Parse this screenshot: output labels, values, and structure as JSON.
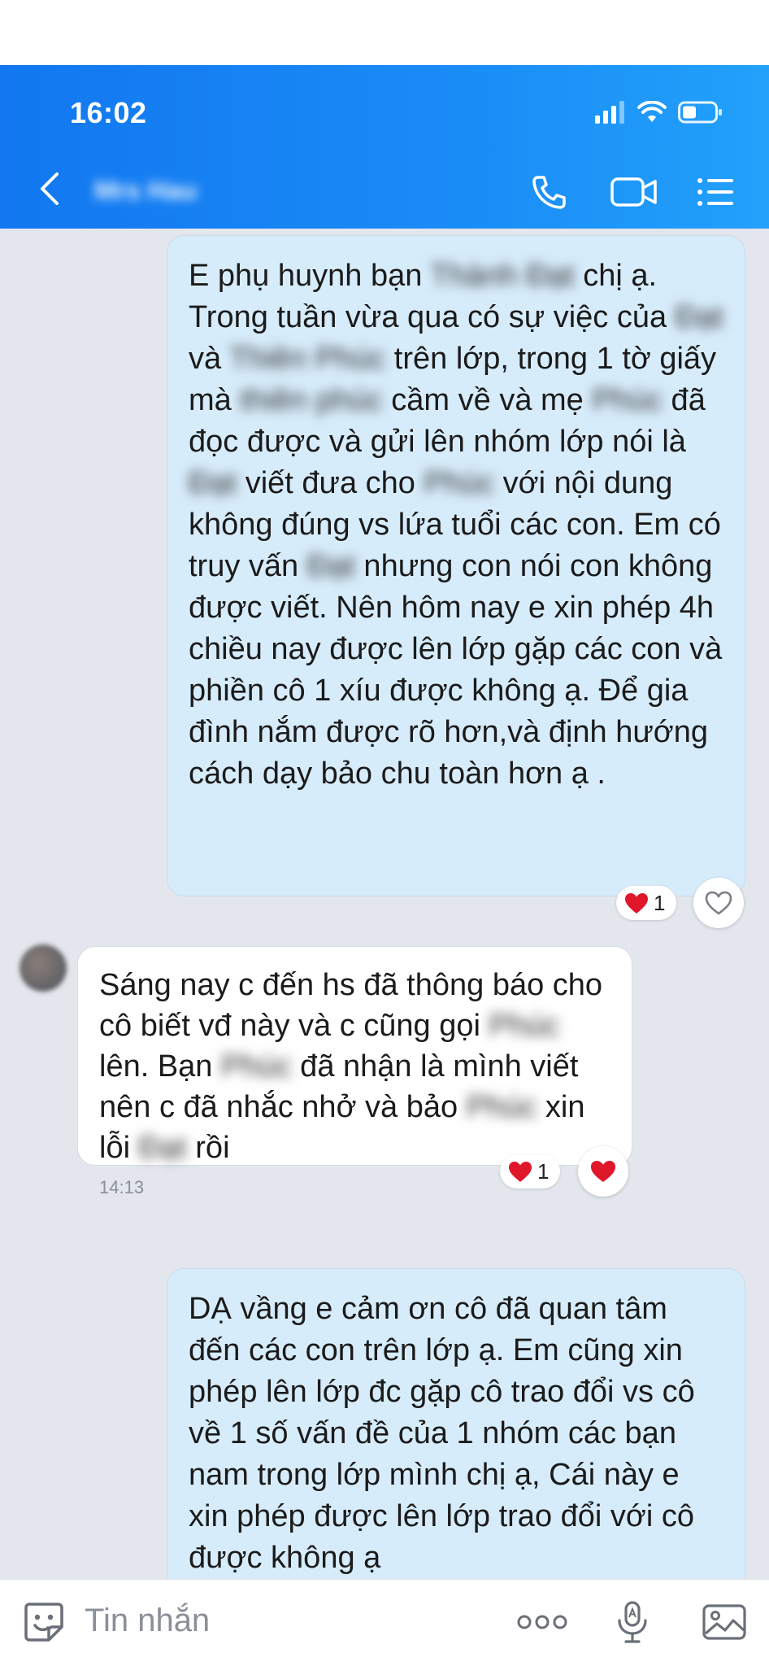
{
  "status_bar": {
    "time": "16:02"
  },
  "header": {
    "contact_name": "Mrs Hau"
  },
  "messages": [
    {
      "segments": [
        "E phụ huynh bạn ",
        "Thành Đạt",
        " chị ạ. Trong tuần vừa qua có sự việc của ",
        "Đạt",
        " và ",
        "Thiên Phúc",
        " trên lớp, trong 1 tờ giấy mà ",
        "thiên phúc",
        " cầm về và mẹ ",
        "Phúc",
        " đã đọc được và gửi lên nhóm lớp nói là ",
        "Đạt",
        " viết đưa cho ",
        "Phúc",
        " với nội dung không đúng vs lứa tuổi các con. Em có truy vấn ",
        "Đạt",
        " nhưng con nói con không được viết. Nên hôm nay e xin phép 4h chiều nay được lên lớp gặp các con và phiền cô 1 xíu được không ạ. Để gia đình nắm được rõ hơn,và định hướng cách dạy bảo chu toàn hơn ạ ."
      ],
      "reaction_count": "1"
    },
    {
      "segments": [
        "Sáng nay c đến hs đã thông báo cho cô biết vđ này và c cũng gọi ",
        "Phúc",
        " lên. Bạn ",
        "Phúc",
        " đã nhận là mình viết nên c đã nhắc nhở và bảo ",
        "Phúc",
        " xin lỗi ",
        "Đạt",
        " rồi"
      ],
      "time": "14:13",
      "reaction_count": "1"
    },
    {
      "text": "DẠ vầng e cảm ơn cô đã quan tâm đến các con trên lớp ạ. Em cũng xin phép lên lớp đc gặp cô trao đổi vs cô về 1 số vấn đề của 1 nhóm các bạn nam trong lớp mình chị ạ, Cái này e xin phép được lên lớp trao đổi với cô được không ạ"
    }
  ],
  "composer": {
    "placeholder": "Tin nhắn"
  },
  "colors": {
    "header": "#1a8cf6",
    "outgoing_bubble": "#d7ecfb",
    "incoming_bubble": "#ffffff",
    "heart": "#e0162b"
  },
  "icons": [
    "back-icon",
    "phone-icon",
    "video-icon",
    "menu-icon",
    "sticker-icon",
    "more-icon",
    "mic-icon",
    "image-icon",
    "heart-icon"
  ]
}
